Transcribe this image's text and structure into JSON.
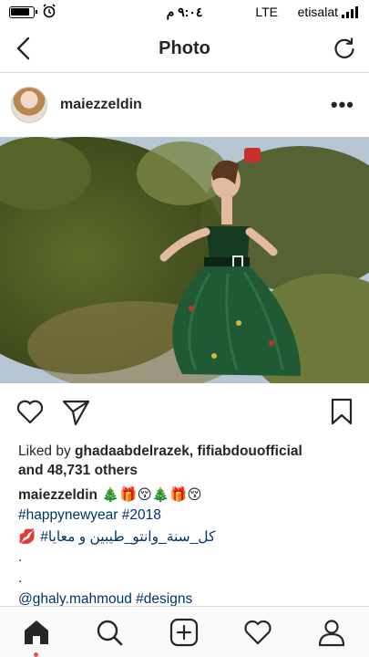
{
  "status_bar": {
    "time": "٩:٠٤ م",
    "network": "LTE",
    "carrier": "etisalat",
    "alarm_icon": "alarm-icon",
    "battery_icon": "battery-icon",
    "signal_icon": "signal-icon"
  },
  "nav": {
    "title": "Photo",
    "back_icon": "chevron-left-icon",
    "refresh_icon": "refresh-icon"
  },
  "post": {
    "username": "maiezzeldin",
    "more_label": "•••",
    "image_icon": "post-photo"
  },
  "actions": {
    "like_icon": "heart-icon",
    "share_icon": "send-icon",
    "save_icon": "bookmark-icon"
  },
  "likes": {
    "prefix": "Liked by ",
    "user1": "ghadaabdelrazek",
    "sep": ", ",
    "user2": "fifiabdouofficial",
    "and": "and ",
    "count": "48,731 others"
  },
  "caption": {
    "username": "maiezzeldin",
    "emojis": " 🎄🎁😚🎄🎁😚",
    "hashtag1": "#happynewyear #2018",
    "line3_emoji": "💋 ",
    "line3_text": "#كل_سنة_وانتو_طيبين و معايا",
    "dot1": ".",
    "dot2": ".",
    "mention": "@ghaly.mahmoud #designs"
  },
  "tabs": {
    "home_icon": "home-icon",
    "search_icon": "search-icon",
    "add_icon": "add-post-icon",
    "activity_icon": "heart-icon",
    "profile_icon": "profile-icon"
  },
  "colors": {
    "link": "#003569",
    "text": "#262626",
    "notification_dot": "#ed4956"
  }
}
